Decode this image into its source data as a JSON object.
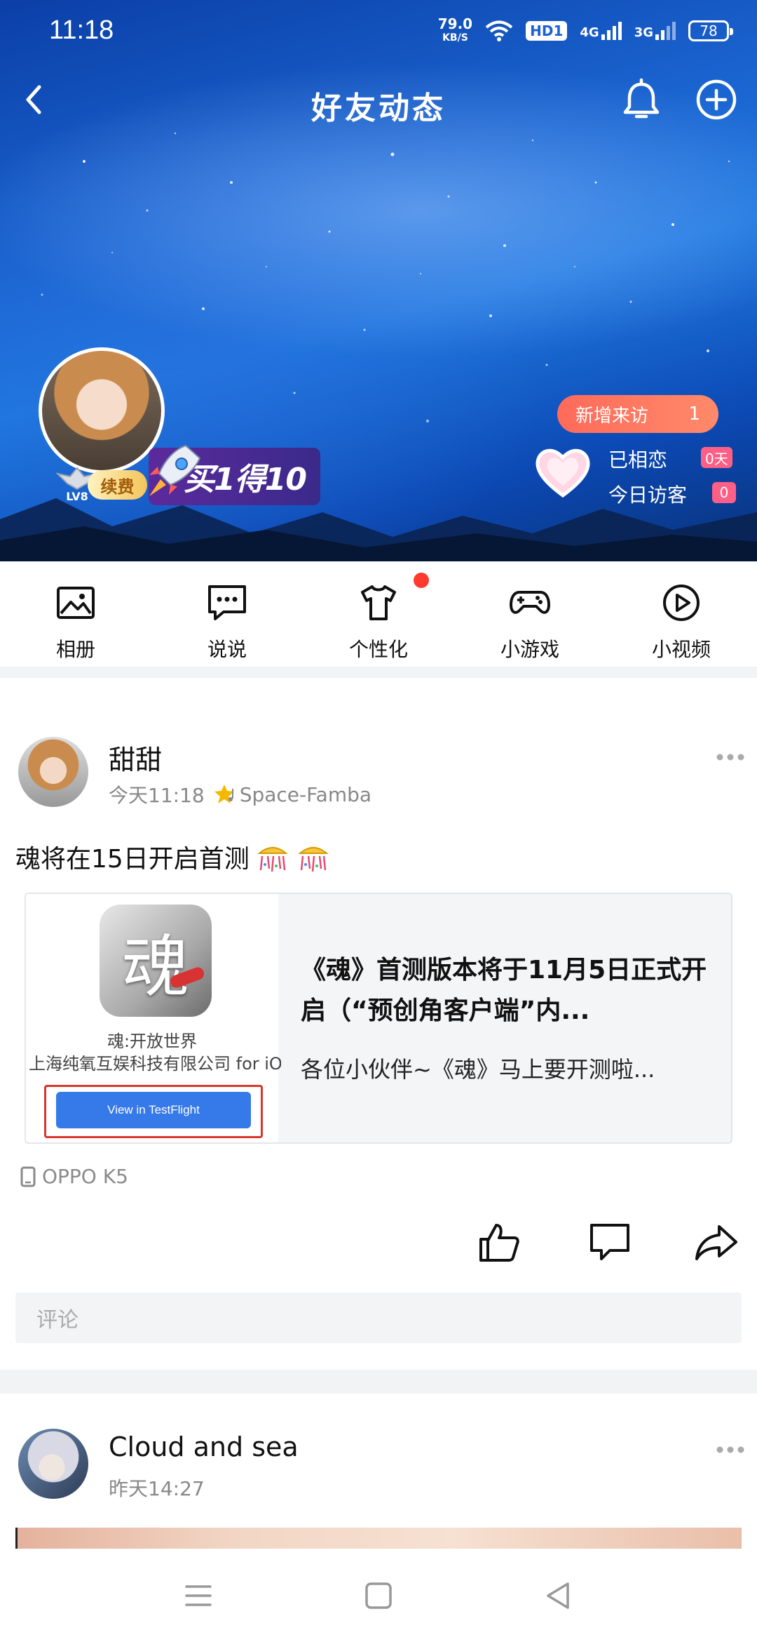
{
  "status_bar": {
    "time": "11:18",
    "net_speed_value": "79.0",
    "net_speed_unit": "KB/S",
    "hd_label": "HD1",
    "network_1": "4G",
    "network_2": "3G",
    "battery": "78"
  },
  "top_bar": {
    "title": "好友动态"
  },
  "profile": {
    "level": "LV8",
    "renew_label": "续费",
    "promo_label": "买1得10",
    "new_visitors_label": "新增来访",
    "new_visitors_count": "1",
    "together_label": "已相恋",
    "together_value": "0天",
    "today_visitors_label": "今日访客",
    "today_visitors_value": "0"
  },
  "features": [
    {
      "label": "相册",
      "icon": "photo-album-icon"
    },
    {
      "label": "说说",
      "icon": "chat-bubble-icon"
    },
    {
      "label": "个性化",
      "icon": "tshirt-icon"
    },
    {
      "label": "小游戏",
      "icon": "gamepad-icon"
    },
    {
      "label": "小视频",
      "icon": "play-circle-icon"
    }
  ],
  "posts": [
    {
      "author": "甜甜",
      "time": "今天11:18",
      "music": "Space-Famba",
      "text": "魂将在15日开启首测",
      "share_card": {
        "app_icon_glyph": "魂",
        "app_name": "魂:开放世界",
        "app_company": "上海纯氧互娱科技有限公司 for iOS",
        "button_label": "View in TestFlight",
        "title": "《魂》首测版本将于11月5日正式开启（“预创角客户端”内...",
        "description": "各位小伙伴~《魂》马上要开测啦..."
      },
      "device": "OPPO K5",
      "comment_placeholder": "评论"
    },
    {
      "author": "Cloud and sea",
      "time": "昨天14:27"
    }
  ],
  "colors": {
    "accent_red": "#ff3b30",
    "visitor_pill": "#ff6a5a",
    "testflight_blue": "#3679e9"
  }
}
